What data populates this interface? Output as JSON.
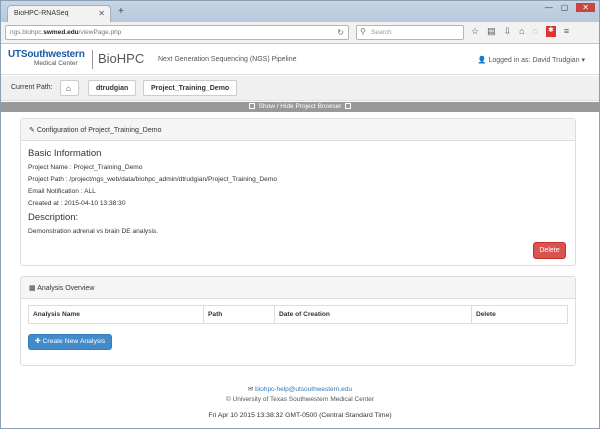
{
  "browser": {
    "tab_title": "BioHPC-RNASeq",
    "url_prefix": "ngs.biohpc.",
    "url_domain": "swmed.edu",
    "url_path": "/viewPage.php",
    "search_placeholder": "Search"
  },
  "header": {
    "logo_ut": "UTSouthwestern",
    "logo_sub": "Medical Center",
    "brand": "BioHPC",
    "subtitle": "Next Generation Sequencing (NGS) Pipeline",
    "login_label": "Logged in as: David Trudgian"
  },
  "breadcrumb": {
    "label": "Current Path:",
    "items": [
      "dtrudgian",
      "Project_Training_Demo"
    ]
  },
  "toggle_label": "Show / Hide Project Browser",
  "config_panel": {
    "title": "Configuration of Project_Training_Demo",
    "basic_heading": "Basic Information",
    "project_name": "Project Name : Project_Training_Demo",
    "project_path": "Project Path : /project/ngs_web/data/biohpc_admin/dtrudgian/Project_Training_Demo",
    "email_notification": "Email Notification : ALL",
    "created_at": "Created at : 2015-04-10 13:38:30",
    "description_heading": "Description:",
    "description": "Demonstration adrenal vs brain DE analysis.",
    "delete_label": "Delete"
  },
  "analysis_panel": {
    "title": "Analysis Overview",
    "columns": [
      "Analysis Name",
      "Path",
      "Date of Creation",
      "Delete"
    ],
    "create_label": "Create New Analysis"
  },
  "footer": {
    "email": "biohpc-help@utsouthwestern.edu",
    "copyright": "© University of Texas Southwestern Medical Center",
    "timestamp": "Fri Apr 10 2015 13:38:32 GMT-0500 (Central Standard Time)"
  },
  "colors": {
    "brand_blue": "#1a5aa6",
    "danger": "#d9534f",
    "primary": "#428bca"
  }
}
